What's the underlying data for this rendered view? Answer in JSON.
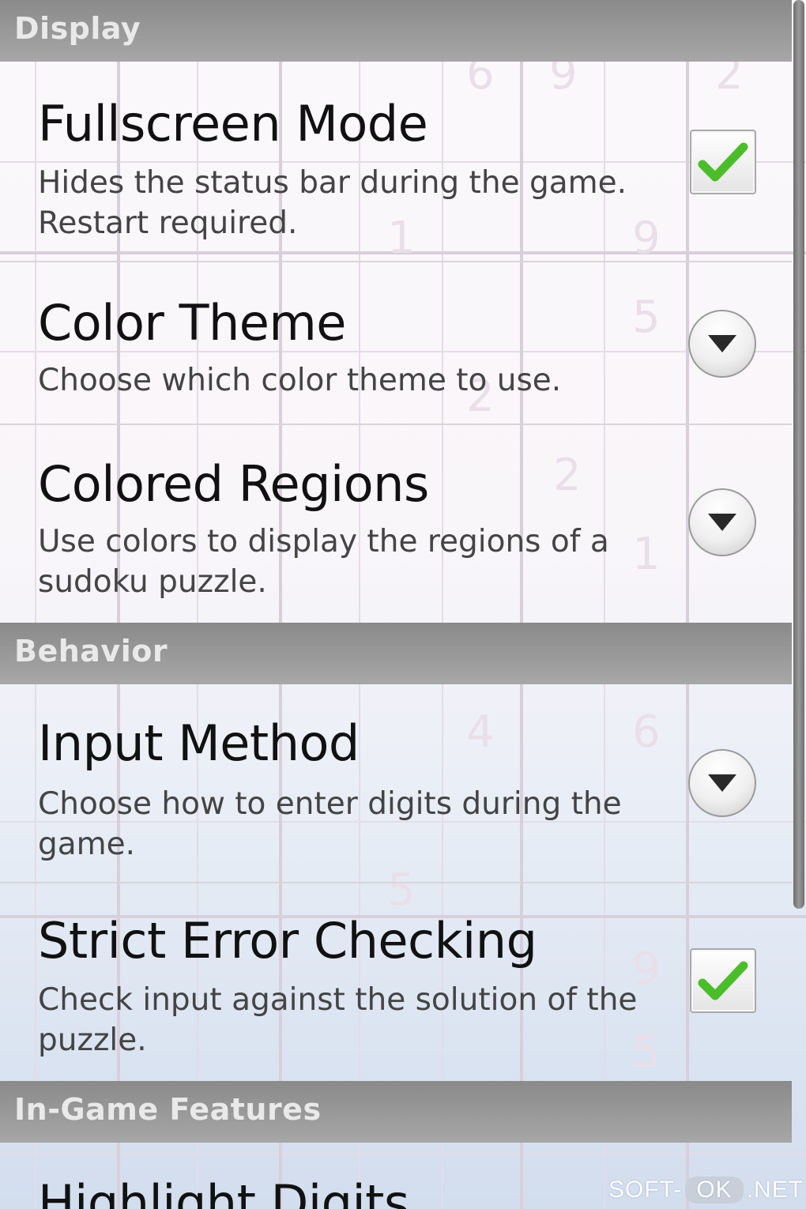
{
  "sections": [
    {
      "header": "Display",
      "items": [
        {
          "title": "Fullscreen Mode",
          "summary": "Hides the status bar during the game. Restart required.",
          "widget": "checkbox",
          "checked": true
        },
        {
          "title": "Color Theme",
          "summary": "Choose which color theme to use.",
          "widget": "dropdown"
        },
        {
          "title": "Colored Regions",
          "summary": "Use colors to display the regions of a sudoku puzzle.",
          "widget": "dropdown"
        }
      ]
    },
    {
      "header": "Behavior",
      "items": [
        {
          "title": "Input Method",
          "summary": "Choose how to enter digits during the game.",
          "widget": "dropdown"
        },
        {
          "title": "Strict Error Checking",
          "summary": "Check input against the solution of the puzzle.",
          "widget": "checkbox",
          "checked": true
        }
      ]
    },
    {
      "header": "In-Game Features",
      "items": [
        {
          "title": "Highlight Digits",
          "summary": "",
          "widget": "none"
        }
      ]
    }
  ],
  "watermark": {
    "left": "SOFT-",
    "middle": "OK",
    "right": ".NET"
  },
  "colors": {
    "section_header_bg": "#9a9a9a",
    "check_green": "#4cbd2a",
    "title_text": "#111111",
    "summary_text": "#444444"
  },
  "icons": {
    "checkbox": "check-mark-icon",
    "dropdown": "chevron-down-icon"
  }
}
